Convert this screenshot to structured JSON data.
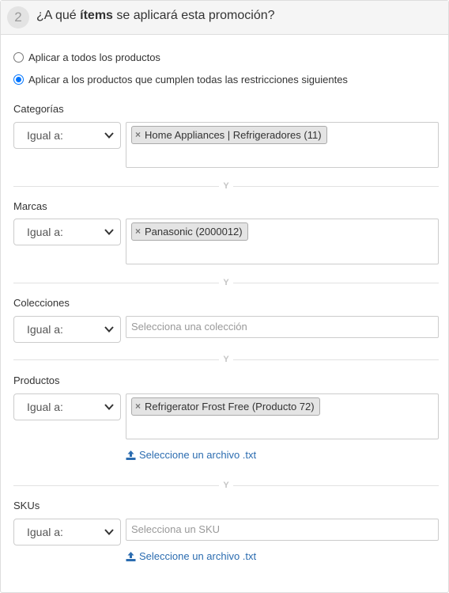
{
  "header": {
    "step": "2",
    "title_pre": "¿A qué ",
    "title_bold": "ítems",
    "title_post": " se aplicará esta promoción?"
  },
  "scope_options": [
    {
      "label": "Aplicar a todos los productos",
      "selected": false
    },
    {
      "label": "Aplicar a los productos que cumplen todas las restricciones siguientes",
      "selected": true
    }
  ],
  "connector_label": "Y",
  "operator_label": "Igual a:",
  "remove_glyph": "×",
  "upload_label": "Seleccione un archivo .txt",
  "sections": {
    "categories": {
      "label": "Categorías",
      "tags": [
        "Home Appliances | Refrigeradores (11)"
      ]
    },
    "brands": {
      "label": "Marcas",
      "tags": [
        "Panasonic (2000012)"
      ]
    },
    "collections": {
      "label": "Colecciones",
      "placeholder": "Selecciona una colección"
    },
    "products": {
      "label": "Productos",
      "tags": [
        "Refrigerator Frost Free (Producto 72)"
      ]
    },
    "skus": {
      "label": "SKUs",
      "placeholder": "Selecciona un SKU"
    }
  },
  "colors": {
    "accent": "#0075ff",
    "link": "#2b6cb0",
    "header_bg": "#f5f5f5",
    "tag_bg": "#e4e4e4"
  },
  "icons": {
    "chevron": "chevron-down-icon",
    "upload": "upload-icon",
    "remove": "close-icon"
  }
}
